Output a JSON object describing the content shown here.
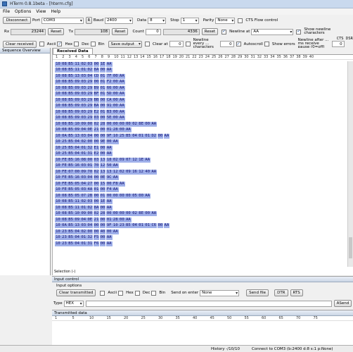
{
  "window": {
    "title": "HTerm 0.8.1beta - [hterm.cfg]"
  },
  "menu": [
    "File",
    "Options",
    "View",
    "Help"
  ],
  "toolbar1": {
    "disconnect": "Disconnect",
    "port_label": "Port",
    "port_value": "COM3",
    "refresh": "R",
    "baud_label": "Baud",
    "baud_value": "2400",
    "data_label": "Data",
    "data_value": "8",
    "stop_label": "Stop",
    "stop_value": "1",
    "parity_label": "Parity",
    "parity_value": "None",
    "cts_label": "CTS Flow control"
  },
  "toolbar2": {
    "rx_label": "Rx",
    "rx_value": "23244",
    "rx_reset": "Reset",
    "tx_label": "Tx",
    "tx_value": "108",
    "tx_reset": "Reset",
    "count_label": "Count",
    "count_value": "0",
    "count_total": "4336",
    "count_reset": "Reset",
    "newline_label": "Newline at",
    "newline_value": "AA",
    "show_newline": "Show newline characters"
  },
  "toolbar3": {
    "clear_received": "Clear received",
    "ascii": "Ascii",
    "hex": "Hex",
    "dec": "Dec",
    "bin": "Bin",
    "save_output": "Save output",
    "clear_at": "Clear at",
    "clear_at_value": "0",
    "newline_every": "Newline every ... characters",
    "newline_every_value": "0",
    "autoscroll": "Autoscroll",
    "show_errors": "Show errors",
    "newline_after": "Newline after ... ms receive pause (0=off)",
    "newline_after_value": "0",
    "cts": "CTS",
    "dsr": "DSR"
  },
  "sequence": {
    "title": "Sequence Overview"
  },
  "received": {
    "tab": "Received Data",
    "ruler": [
      "1",
      "2",
      "3",
      "4",
      "5",
      "6",
      "7",
      "8",
      "9",
      "10",
      "11",
      "12",
      "13",
      "14",
      "15",
      "16",
      "17",
      "18",
      "19",
      "20",
      "21",
      "22",
      "23",
      "24",
      "25",
      "26",
      "27",
      "28",
      "29",
      "30",
      "31",
      "32",
      "33",
      "34",
      "35",
      "36",
      "37",
      "38",
      "39",
      "40"
    ],
    "selection": "Selection (-)",
    "lines": [
      "10 08 B5 11 02 03 00 1E AA",
      "10 08 B5 11 01 02 8A 00 AA",
      "10 08 B5 13 03 04 CD 01 7F 00 AA",
      "10 08 B5 09 03 29 00 01 F2 00 AA",
      "10 08 B5 09 03 29 B9 01 66 00 AA",
      "10 08 B5 09 03 29 BF 01 5D 00 AA",
      "10 08 B5 09 03 29 BB 00 CA 00 AA",
      "10 08 B5 09 03 29 BA 00 91 00 AA",
      "10 08 B5 09 03 29 E2 01 B3 00 AA",
      "10 08 B5 09 03 29 03 00 5E 00 AA",
      "10 08 B5 10 09 00 02 28 00 00 00 00 02 8E 00 AA",
      "10 08 B5 09 04 0E 21 00 01 28 00 AA",
      "10 0A B5 13 03 04 00 00 9F 10 25 B5 04 01 01 D2 00 AA",
      "10 25 B5 04 02 00 00 9E 00 AA",
      "10 25 B5 04 01 32 E1 00 AA",
      "10 25 B5 04 01 31 E2 00 AA",
      "10 FE B5 16 08 00 03 13 18 02 09 07 12 1E AA",
      "10 FE B5 16 03 01 70 12 50 AA",
      "10 FE 07 00 09 70 02 13 13 12 02 09 16 12 40 AA",
      "10 FE B5 16 03 04 00 0E 9C AA",
      "10 FE B5 05 04 27 00 15 00 F8 AA",
      "10 FE B5 05 03 4A 01 00 F4 AA",
      "10 08 B5 05 07 2B 00 01 00 00 00 00 05 00 AA",
      "10 08 B5 11 02 03 00 1E AA",
      "10 08 B5 11 01 02 8A 00 AA",
      "10 08 B5 10 09 00 02 28 00 00 00 00 02 8E 00 AA",
      "10 08 B5 09 04 0E 21 00 01 28 00 AA",
      "10 0A B5 13 03 04 00 00 9F 10 23 B5 04 01 01 C6 00 AA",
      "10 23 B5 04 02 00 00 40 00 AA",
      "10 23 B5 04 01 32 F5 00 AA",
      "10 23 B5 04 01 31 F6 00 AA"
    ]
  },
  "input": {
    "title": "Input control",
    "options_label": "Input options",
    "clear_transmitted": "Clear transmitted",
    "ascii": "Ascii",
    "hex": "Hex",
    "dec": "Dec",
    "bin": "Bin",
    "send_on_enter_label": "Send on enter",
    "send_on_enter_value": "None",
    "send_file": "Send file",
    "dtr": "DTR",
    "rts": "RTS",
    "type_label": "Type",
    "type_value": "HEX",
    "asend": "ASend"
  },
  "transmitted": {
    "title": "Transmitted data",
    "ruler": [
      "1",
      "5",
      "10",
      "15",
      "20",
      "25",
      "30",
      "35",
      "40",
      "45",
      "50",
      "55",
      "60",
      "65",
      "70",
      "75"
    ]
  },
  "status": {
    "history": "History -/10/10",
    "connection": "Connect to COM3 (b:2400 d:8 s:1 p:None)"
  }
}
